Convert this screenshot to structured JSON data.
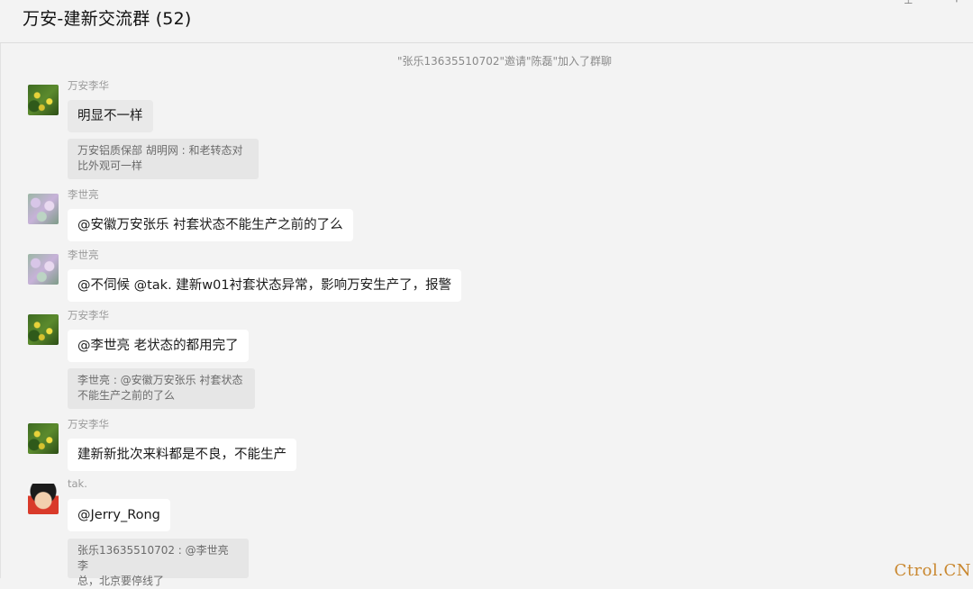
{
  "header": {
    "title": "万安-建新交流群 (52)",
    "icons": [
      "pin-icon",
      "popout-icon"
    ]
  },
  "system_message": "\"张乐13635510702\"邀请\"陈磊\"加入了群聊",
  "messages": [
    {
      "sender": "万安李华",
      "avatar": "green-leaves-avatar",
      "text": "明显不一样",
      "quote": "万安铝质保部  胡明网 : 和老转态对\n比外观可一样"
    },
    {
      "sender": "李世亮",
      "avatar": "flower-avatar",
      "text": "@安徽万安张乐 衬套状态不能生产之前的了么"
    },
    {
      "sender": "李世亮",
      "avatar": "flower-avatar",
      "text": "@不伺候 @tak. 建新w01衬套状态异常，影响万安生产了，报警"
    },
    {
      "sender": "万安李华",
      "avatar": "green-leaves-avatar",
      "text": "@李世亮 老状态的都用完了",
      "quote": "李世亮 : @安徽万安张乐 衬套状态\n不能生产之前的了么"
    },
    {
      "sender": "万安李华",
      "avatar": "green-leaves-avatar",
      "text": "建新新批次来料都是不良，不能生产"
    },
    {
      "sender": "tak.",
      "avatar": "anime-avatar",
      "text": "@Jerry_Rong",
      "quote": "张乐13635510702 : @李世亮 李\n总，北京要停线了"
    }
  ],
  "watermark": "Ctrol.CN"
}
